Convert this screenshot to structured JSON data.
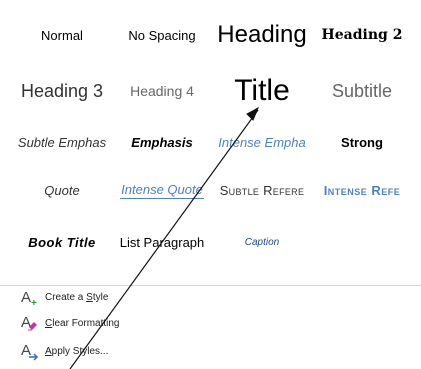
{
  "gallery": {
    "rows": [
      [
        {
          "label": "Normal",
          "cls": "s-normal"
        },
        {
          "label": "No Spacing",
          "cls": "s-nospacing"
        },
        {
          "label": "Heading",
          "cls": "s-heading"
        },
        {
          "label": "Heading 2",
          "cls": "s-heading2"
        }
      ],
      [
        {
          "label": "Heading 3",
          "cls": "s-heading3"
        },
        {
          "label": "Heading 4",
          "cls": "s-heading4"
        },
        {
          "label": "Title",
          "cls": "s-title"
        },
        {
          "label": "Subtitle",
          "cls": "s-subtitle"
        }
      ],
      [
        {
          "label": "Subtle Emphas",
          "cls": "s-subtle"
        },
        {
          "label": "Emphasis",
          "cls": "s-emphasis"
        },
        {
          "label": "Intense Empha",
          "cls": "s-intense"
        },
        {
          "label": "Strong",
          "cls": "s-strong"
        }
      ],
      [
        {
          "label": "Quote",
          "cls": "s-quote"
        },
        {
          "label": "Intense Quote",
          "cls": "s-iquote"
        },
        {
          "label": "Subtle Refere",
          "cls": "s-subref"
        },
        {
          "label": "Intense Refe",
          "cls": "s-intref"
        }
      ],
      [
        {
          "label": "Book Title",
          "cls": "s-booktitle"
        },
        {
          "label": "List Paragraph",
          "cls": "s-listpara"
        },
        {
          "label": "Caption",
          "cls": "s-caption"
        },
        null
      ]
    ]
  },
  "menu": {
    "create_style": {
      "pre": "Create a ",
      "key": "S",
      "post": "tyle"
    },
    "clear_formatting": {
      "pre": "",
      "key": "C",
      "post": "lear Formatting"
    },
    "apply_styles": {
      "pre": "",
      "key": "A",
      "post": "pply Styles..."
    }
  },
  "colors": {
    "accent": "#4f81bd",
    "create_icon_plus": "#2e9a3a",
    "clear_icon": "#c0399a",
    "apply_icon_arrow": "#2f6fba"
  }
}
